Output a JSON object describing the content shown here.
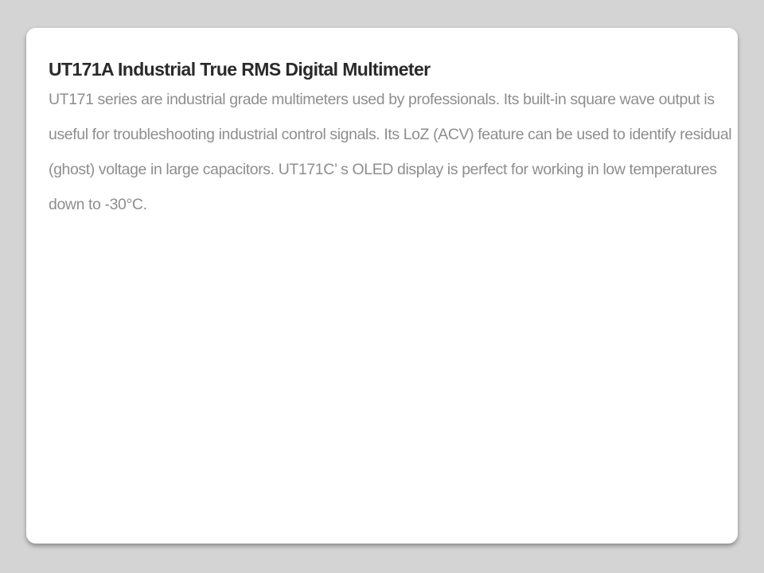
{
  "product": {
    "title": "UT171A Industrial True RMS Digital Multimeter",
    "description": "UT171 series are industrial grade multimeters used by professionals. Its built-in square wave output is useful for troubleshooting industrial control signals. Its LoZ (ACV) feature can be used to identify residual (ghost) voltage in large capacitors. UT171C’ s OLED display is perfect for working in low temperatures down to -30°C."
  },
  "colors": {
    "background": "#d4d4d4",
    "card": "#ffffff",
    "title": "#2a2a2a",
    "description": "#8e8e8e"
  }
}
